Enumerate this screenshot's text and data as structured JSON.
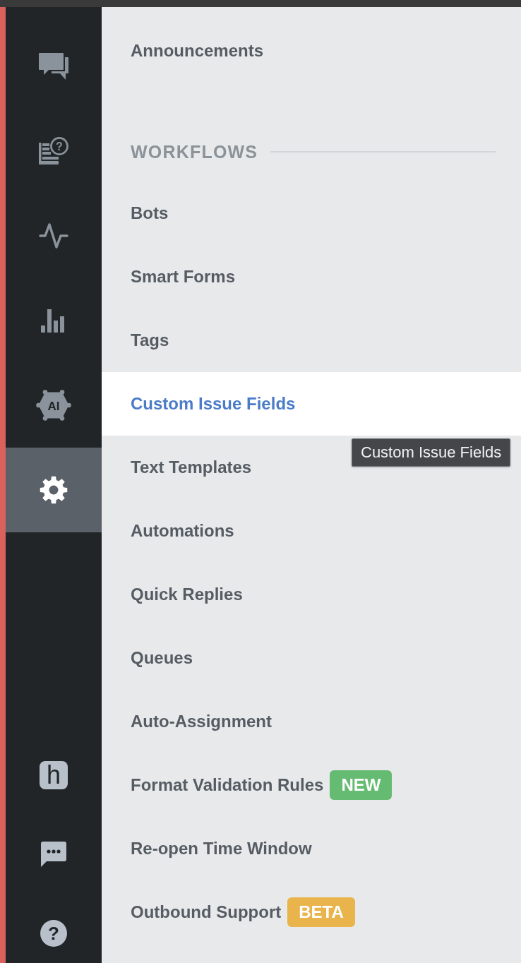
{
  "sidebar": {
    "items": [
      {
        "selected": false
      },
      {
        "selected": false,
        "glyph": "?"
      },
      {
        "selected": false
      },
      {
        "selected": false
      },
      {
        "selected": false,
        "glyph": "AI"
      },
      {
        "selected": true
      }
    ],
    "bottom_items": [
      {
        "selected": false,
        "glyph": "h"
      },
      {
        "selected": false
      },
      {
        "selected": false,
        "glyph": "?"
      }
    ]
  },
  "menu": {
    "items": [
      {
        "label": "Announcements",
        "selected": false
      }
    ],
    "sections": [
      {
        "title": "WORKFLOWS",
        "items": [
          {
            "label": "Bots",
            "selected": false
          },
          {
            "label": "Smart Forms",
            "selected": false
          },
          {
            "label": "Tags",
            "selected": false
          },
          {
            "label": "Custom Issue Fields",
            "selected": true
          },
          {
            "label": "Text Templates",
            "selected": false
          },
          {
            "label": "Automations",
            "selected": false
          },
          {
            "label": "Quick Replies",
            "selected": false
          },
          {
            "label": "Queues",
            "selected": false
          },
          {
            "label": "Auto-Assignment",
            "selected": false
          },
          {
            "label": "Format Validation Rules",
            "selected": false,
            "badge": {
              "text": "NEW",
              "color": "#66bb72"
            }
          },
          {
            "label": "Re-open Time Window",
            "selected": false
          },
          {
            "label": "Outbound Support",
            "selected": false,
            "badge": {
              "text": "BETA",
              "color": "#e9b44c"
            }
          }
        ]
      }
    ]
  },
  "tooltip": {
    "text": "Custom Issue Fields"
  }
}
